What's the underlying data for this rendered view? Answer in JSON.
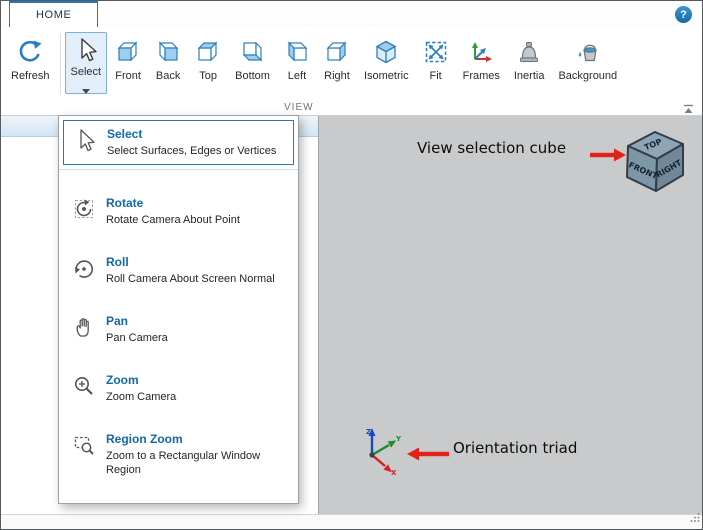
{
  "tab_bar": {
    "home_tab": "HOME",
    "help_label": "?"
  },
  "ribbon": {
    "section_label": "VIEW",
    "buttons": [
      {
        "label": "Refresh"
      },
      {
        "label": "Select"
      },
      {
        "label": "Front"
      },
      {
        "label": "Back"
      },
      {
        "label": "Top"
      },
      {
        "label": "Bottom"
      },
      {
        "label": "Left"
      },
      {
        "label": "Right"
      },
      {
        "label": "Isometric"
      },
      {
        "label": "Fit"
      },
      {
        "label": "Frames"
      },
      {
        "label": "Inertia"
      },
      {
        "label": "Background"
      }
    ]
  },
  "dropdown": {
    "items": [
      {
        "title": "Select",
        "subtitle": "Select Surfaces, Edges or Vertices"
      },
      {
        "title": "Rotate",
        "subtitle": "Rotate Camera About Point"
      },
      {
        "title": "Roll",
        "subtitle": "Roll Camera About Screen Normal"
      },
      {
        "title": "Pan",
        "subtitle": "Pan Camera"
      },
      {
        "title": "Zoom",
        "subtitle": "Zoom Camera"
      },
      {
        "title": "Region Zoom",
        "subtitle": "Zoom to a Rectangular Window Region"
      }
    ]
  },
  "canvas": {
    "cube_annotation": "View selection cube",
    "triad_annotation": "Orientation triad",
    "cube_faces": {
      "top": "TOP",
      "front": "FRONT",
      "right": "RIGHT"
    },
    "triad_axes": {
      "x": "X",
      "y": "Y",
      "z": "Z"
    }
  },
  "colors": {
    "accent_blue": "#2277b9",
    "dropdown_title_blue": "#1268a8",
    "annotation_red": "#e2231a",
    "canvas_gray": "#c9cacb"
  }
}
